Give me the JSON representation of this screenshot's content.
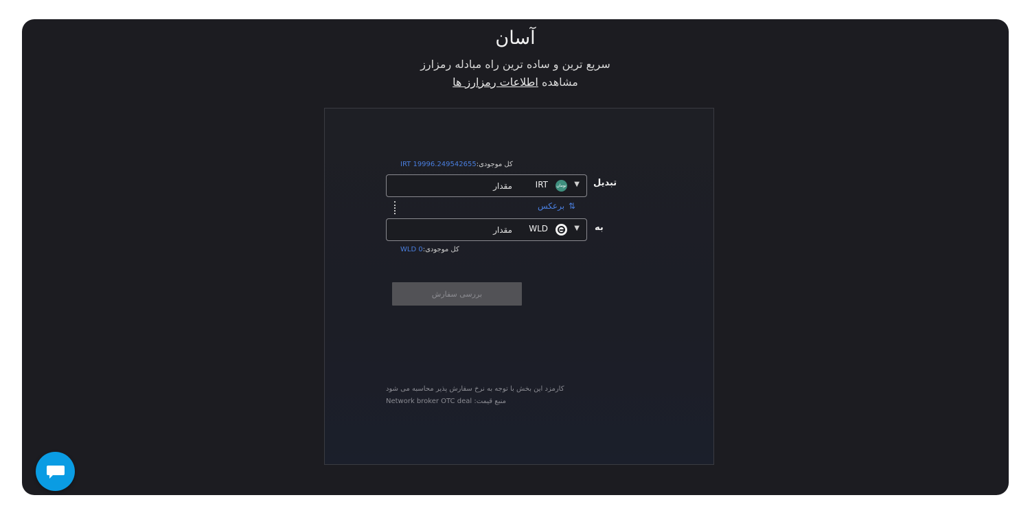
{
  "hero": {
    "title": "آسان",
    "subtitle": "سریع ترین و ساده ترین راه مبادله رمزارز",
    "view_prefix": "مشاهده",
    "view_link": "اطلاعات رمزارز ها"
  },
  "converter": {
    "from": {
      "label": "تبدیل",
      "balance_label": "کل موجودی:",
      "balance_value": "IRT 19996.249542655",
      "coin_code": "IRT",
      "coin_icon": "toman-icon",
      "coin_icon_text": "تومان",
      "amount_placeholder": "مقدار"
    },
    "reverse_label": "برعکس",
    "to": {
      "label": "به",
      "balance_label": "کل موجودی:",
      "balance_value": "WLD 0",
      "coin_code": "WLD",
      "coin_icon": "worldcoin-icon",
      "amount_placeholder": "مقدار"
    },
    "submit_label": "بررسی سفارش",
    "fee_note": "کارمزد این بخش با توجه به نرخ سفارش پذیر محاسبه می شود",
    "price_source": "منبع قیمت: Network broker OTC deal"
  },
  "colors": {
    "background": "#1c1c21",
    "accent_link": "#4a7fe0",
    "chat_button": "#0a9ce3",
    "submit_disabled": "#525256"
  }
}
